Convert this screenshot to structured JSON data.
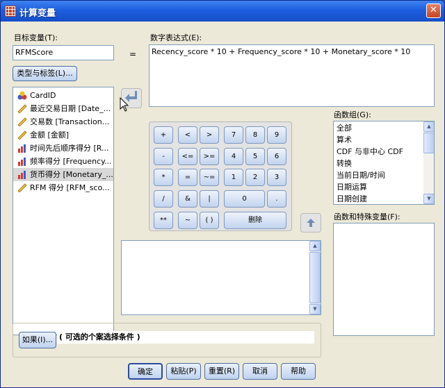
{
  "window": {
    "title": "计算变量",
    "close_glyph": "✕"
  },
  "target": {
    "label": "目标变量(T):",
    "value": "RFMScore",
    "type_label_button": "类型与标签(L)..."
  },
  "equals": "=",
  "expression": {
    "label": "数字表达式(E):",
    "value": "Recency_score * 10 + Frequency_score * 10 + Monetary_score * 10"
  },
  "variables": [
    {
      "label": "CardID",
      "icon": "nominal-icon"
    },
    {
      "label": "最近交易日期 [Date_...",
      "icon": "scale-icon"
    },
    {
      "label": "交易数 [Transaction...",
      "icon": "scale-icon"
    },
    {
      "label": "金额 [金额]",
      "icon": "scale-icon"
    },
    {
      "label": "时间先后顺序得分 [R...",
      "icon": "ordinal-icon"
    },
    {
      "label": "频率得分 [Frequency...",
      "icon": "ordinal-icon"
    },
    {
      "label": "货币得分 [Monetary_...",
      "icon": "ordinal-icon",
      "selected": true
    },
    {
      "label": "RFM 得分 [RFM_sco...",
      "icon": "scale-icon"
    }
  ],
  "keypad": {
    "plus": "+",
    "lt": "<",
    "gt": ">",
    "k7": "7",
    "k8": "8",
    "k9": "9",
    "minus": "-",
    "le": "<=",
    "ge": ">=",
    "k4": "4",
    "k5": "5",
    "k6": "6",
    "mult": "*",
    "eq": "=",
    "ne": "~=",
    "k1": "1",
    "k2": "2",
    "k3": "3",
    "div": "/",
    "amp": "&",
    "pipe": "|",
    "k0": "0",
    "dot": ".",
    "pow": "**",
    "tilde": "~",
    "paren": "( )",
    "delete": "删除"
  },
  "function_group": {
    "label": "函数组(G):",
    "items": [
      "全部",
      "算术",
      "CDF 与非中心 CDF",
      "转换",
      "当前日期/时间",
      "日期运算",
      "日期创建"
    ]
  },
  "functions_label": "函数和特殊变量(F):",
  "if_button": "如果(I)...",
  "if_hint": "( 可选的个案选择条件 )",
  "buttons": {
    "ok": "确定",
    "paste": "粘贴(P)",
    "reset": "重置(R)",
    "cancel": "取消",
    "help": "帮助"
  },
  "colors": {
    "title_blue": "#1d5ee0",
    "dialog_bg": "#ece9d8",
    "selected_row": "#d8d8d8",
    "close_red": "#c8421e"
  }
}
